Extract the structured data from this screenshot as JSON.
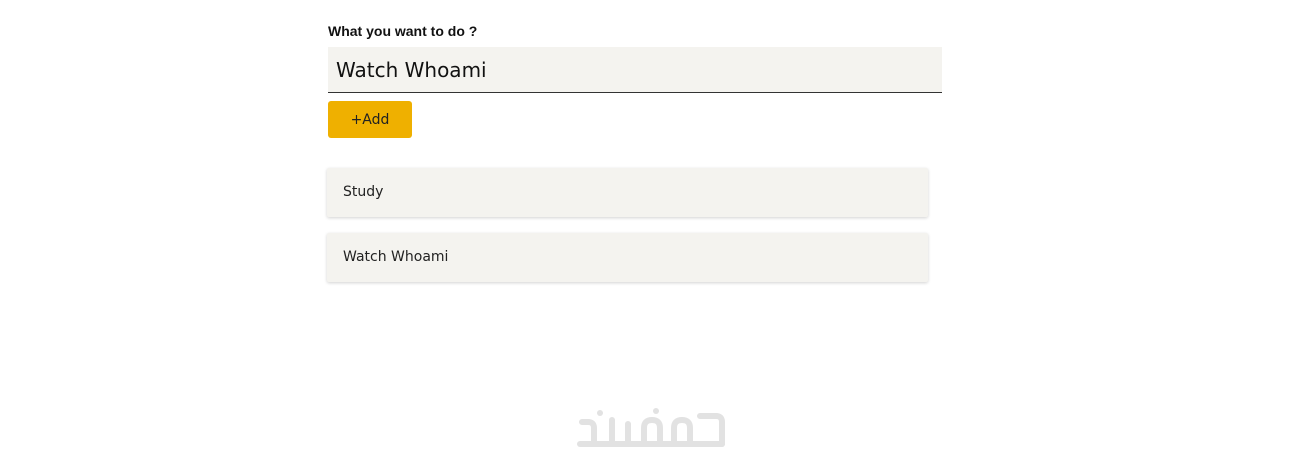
{
  "form": {
    "prompt_label": "What you want to do ?",
    "input_value": "Watch Whoami",
    "add_button_label": "+Add"
  },
  "todos": [
    {
      "label": "Study"
    },
    {
      "label": "Watch Whoami"
    }
  ],
  "watermark": {
    "text": "خمسات"
  },
  "colors": {
    "accent": "#efb000",
    "item_background": "#f4f3ef",
    "watermark": "#e2e2e2"
  }
}
